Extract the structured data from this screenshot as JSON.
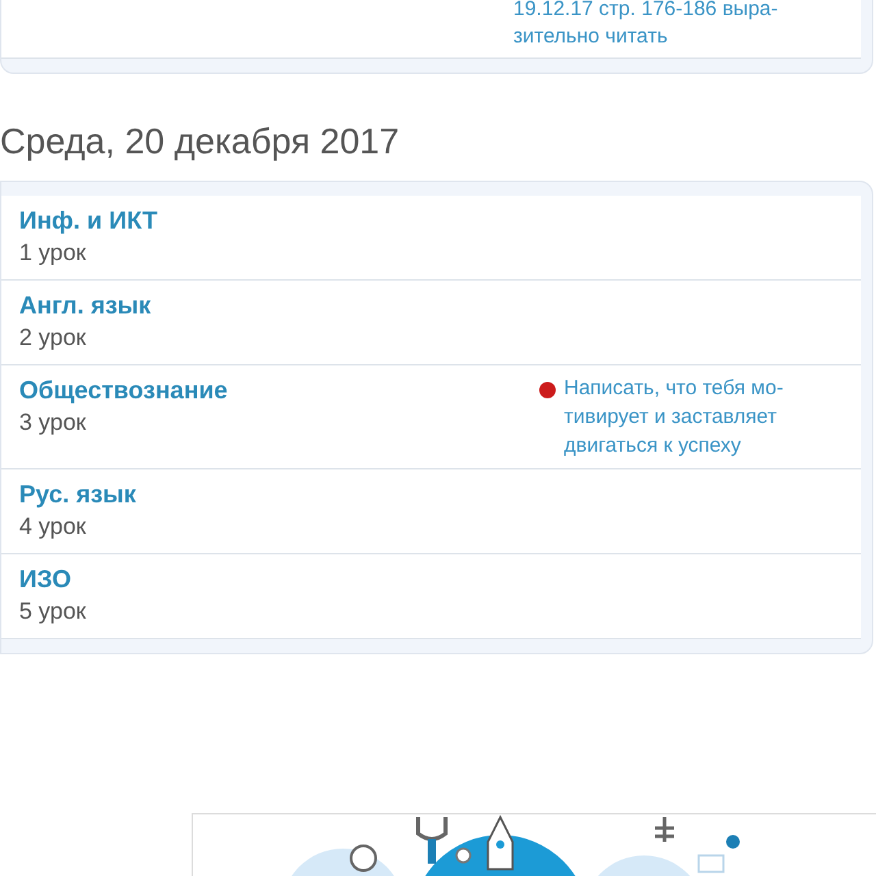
{
  "previous_day": {
    "homework": "19.12.17 стр. 176-186 выра-\nзительно читать"
  },
  "day": {
    "title": "Среда, 20 декабря 2017",
    "lessons": [
      {
        "subject": "Инф. и ИКТ",
        "number": "1 урок"
      },
      {
        "subject": "Англ. язык",
        "number": "2 урок"
      },
      {
        "subject": "Обществознание",
        "number": "3 урок",
        "homework": {
          "text": "Написать, что тебя мо-\nтивирует и заставляет\nдвигаться к успеху",
          "color": "#cc1b1b"
        }
      },
      {
        "subject": "Рус. язык",
        "number": "4 урок"
      },
      {
        "subject": "ИЗО",
        "number": "5 урок"
      }
    ]
  }
}
